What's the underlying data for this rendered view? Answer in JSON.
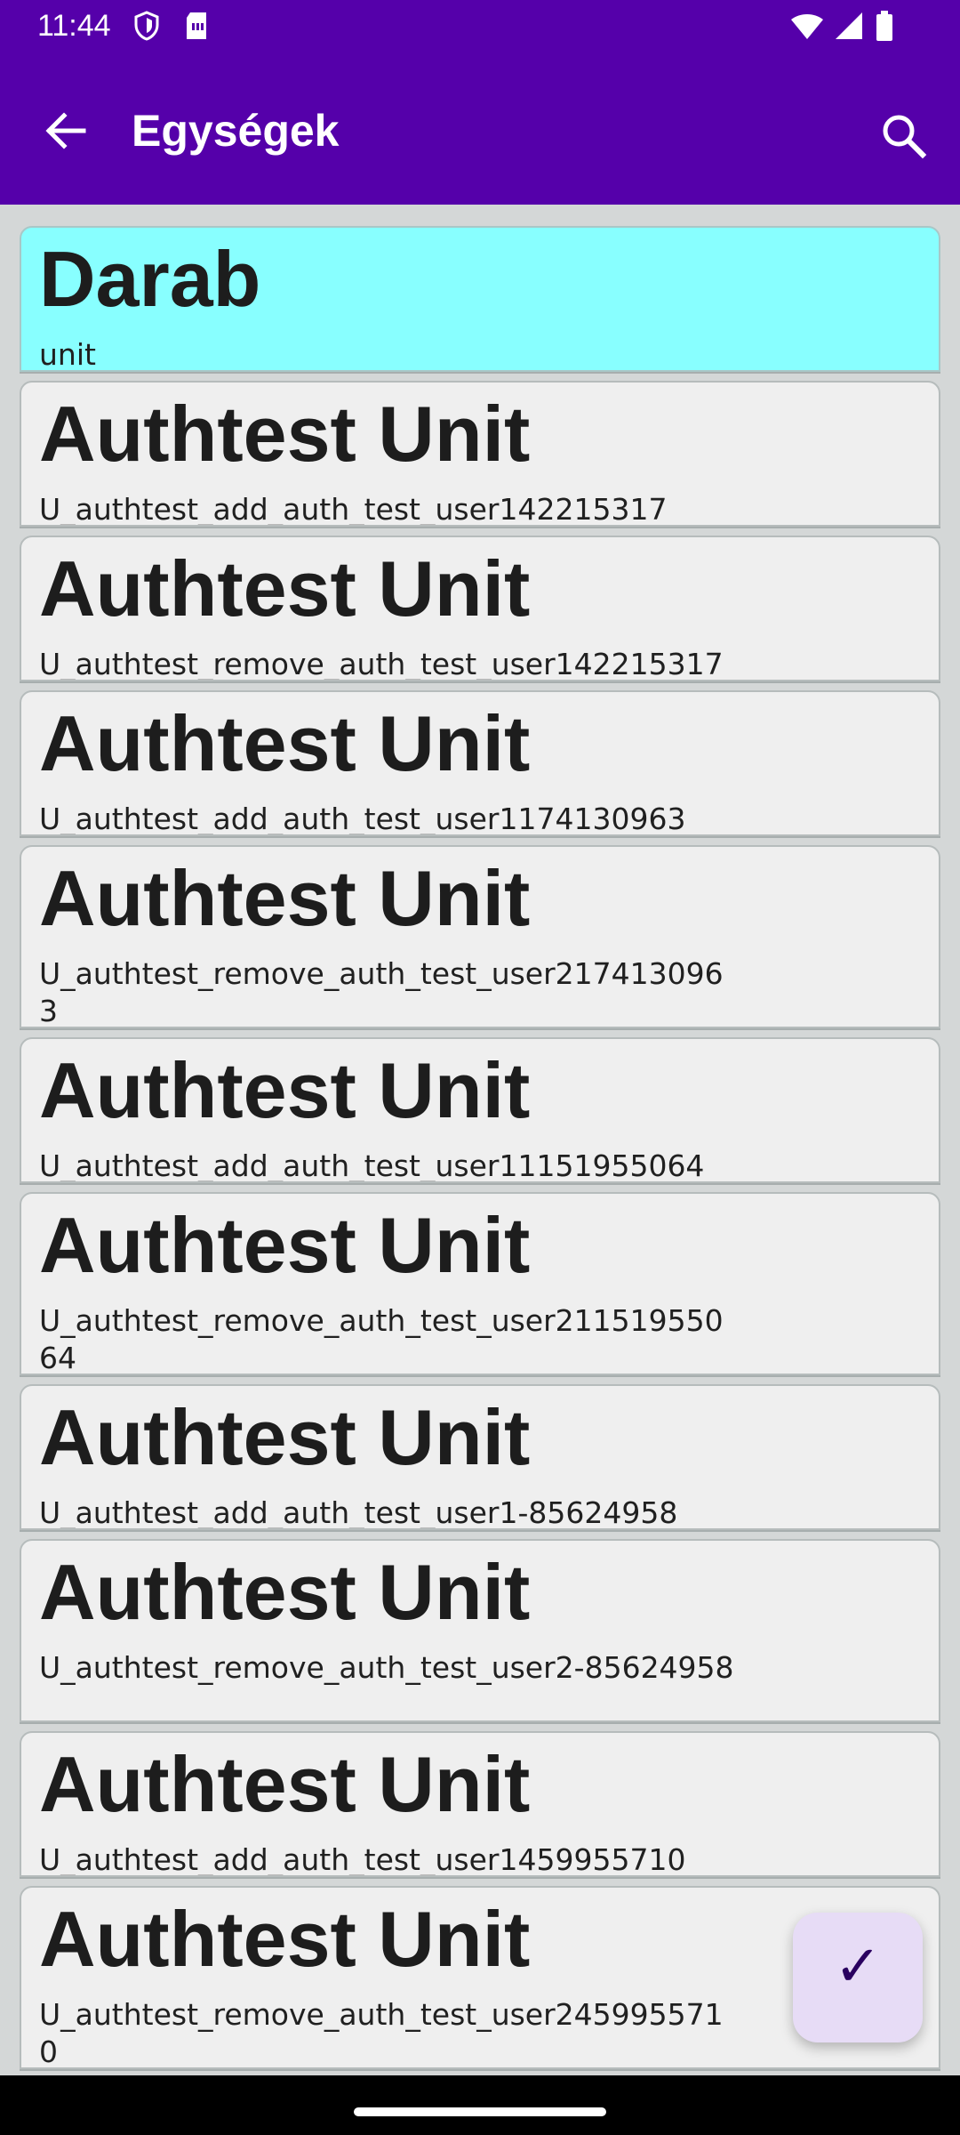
{
  "status": {
    "time": "11:44"
  },
  "appbar": {
    "title": "Egységek"
  },
  "units": [
    {
      "title": "Darab",
      "subtitle": "unit"
    },
    {
      "title": "Authtest Unit",
      "subtitle": "U_authtest_add_auth_test_user142215317"
    },
    {
      "title": "Authtest Unit",
      "subtitle": "U_authtest_remove_auth_test_user142215317"
    },
    {
      "title": "Authtest Unit",
      "subtitle": "U_authtest_add_auth_test_user1174130963"
    },
    {
      "title": "Authtest Unit",
      "subtitle": "U_authtest_remove_auth_test_user2174130963"
    },
    {
      "title": "Authtest Unit",
      "subtitle": "U_authtest_add_auth_test_user11151955064"
    },
    {
      "title": "Authtest Unit",
      "subtitle": "U_authtest_remove_auth_test_user21151955064"
    },
    {
      "title": "Authtest Unit",
      "subtitle": "U_authtest_add_auth_test_user1-85624958"
    },
    {
      "title": "Authtest Unit",
      "subtitle": "U_authtest_remove_auth_test_user2-85624958"
    },
    {
      "title": "Authtest Unit",
      "subtitle": "U_authtest_add_auth_test_user1459955710"
    },
    {
      "title": "Authtest Unit",
      "subtitle": "U_authtest_remove_auth_test_user2459955710"
    }
  ],
  "fab": {
    "icon": "checkmark-icon",
    "glyph": "✓"
  },
  "colors": {
    "primary": "#5500aa",
    "selected": "#88ffff",
    "fab": "#e7dcf6"
  }
}
